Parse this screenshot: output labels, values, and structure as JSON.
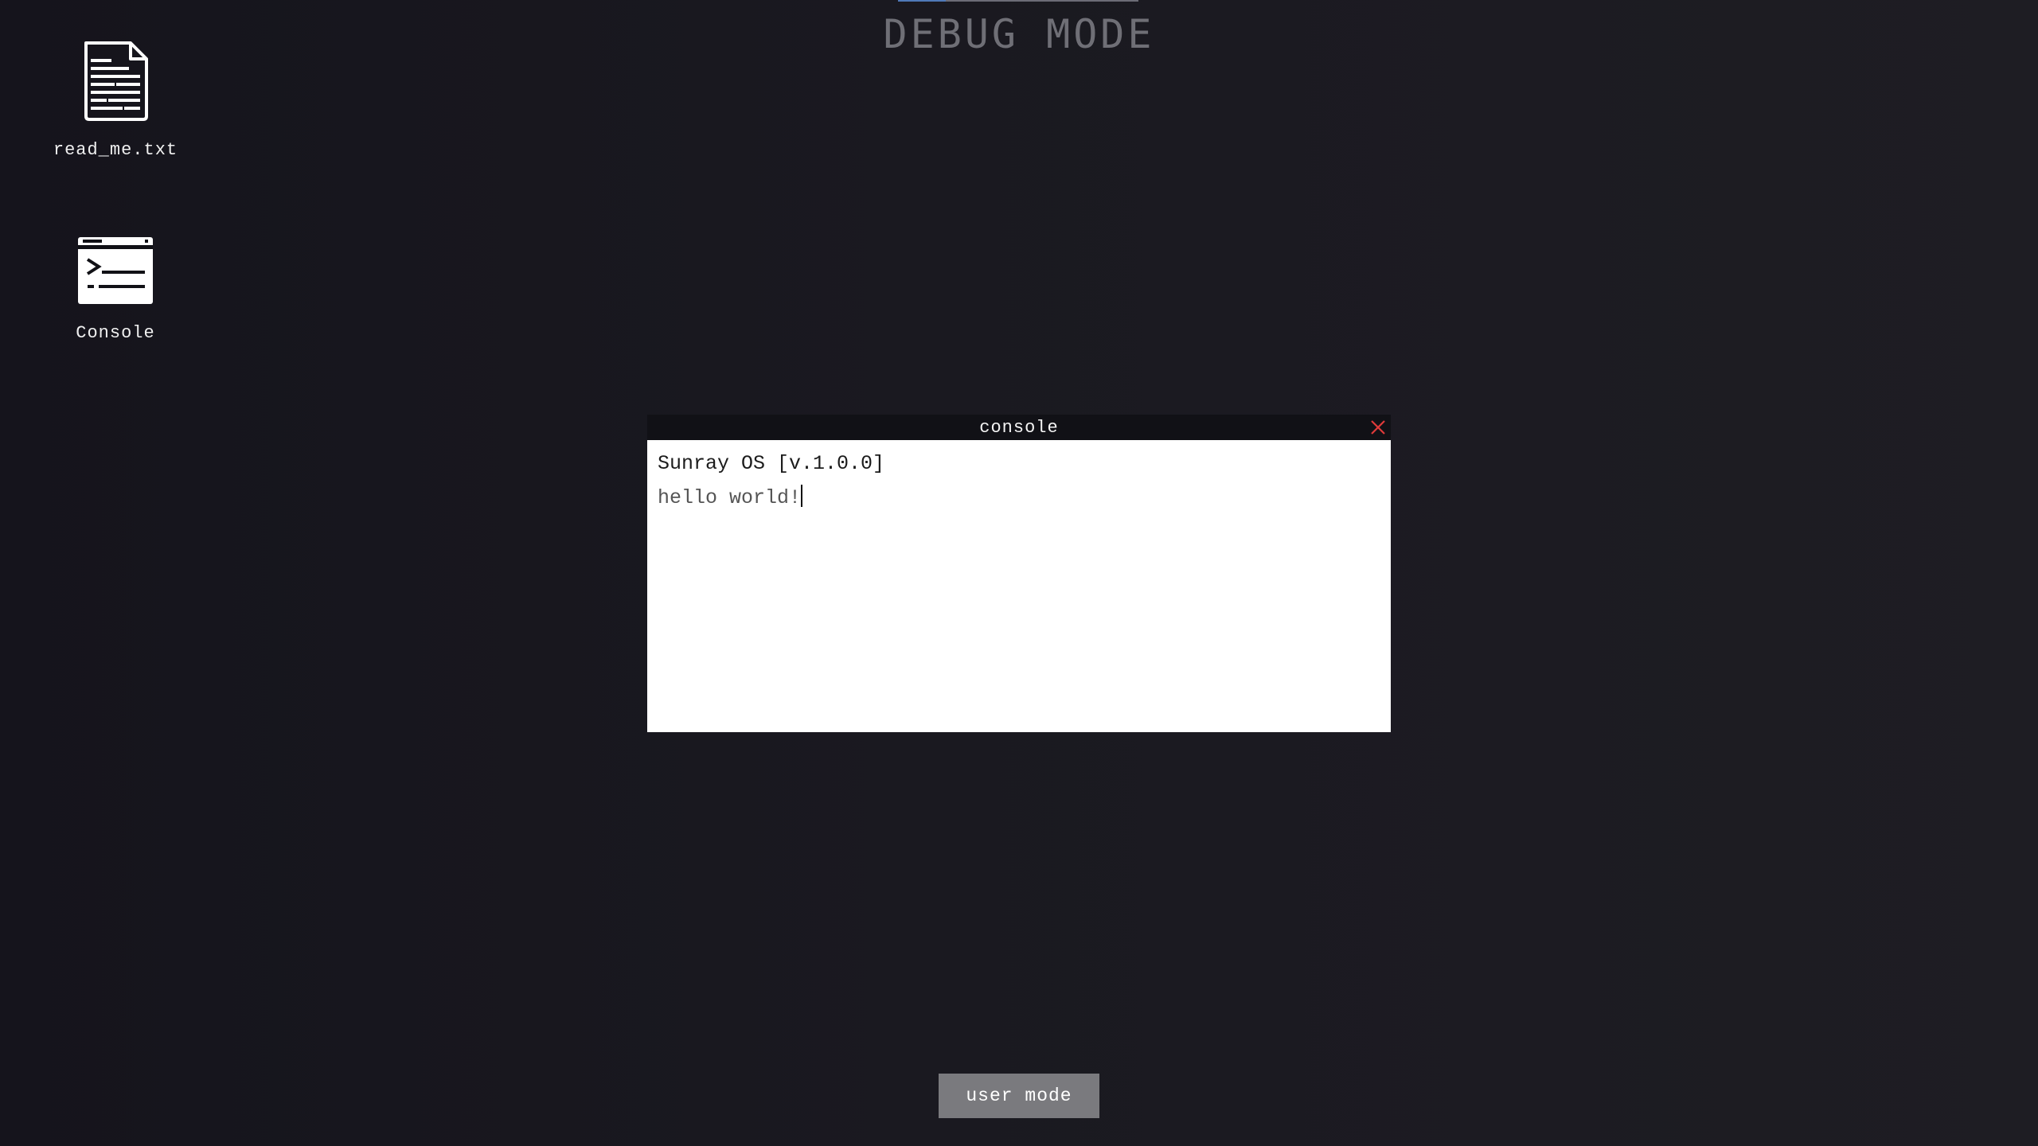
{
  "page": {
    "title": "DEBUG MODE",
    "background_color": "#18171e"
  },
  "desktop": {
    "icons": [
      {
        "name": "document-icon",
        "label": "read_me.txt"
      },
      {
        "name": "terminal-icon",
        "label": "Console"
      }
    ]
  },
  "console_window": {
    "title": "console",
    "close_icon": "close-icon",
    "close_color": "#e03a3a",
    "lines": [
      "Sunray OS [v.1.0.0]",
      "hello world!"
    ]
  },
  "mode_switch": {
    "label": "user mode"
  }
}
